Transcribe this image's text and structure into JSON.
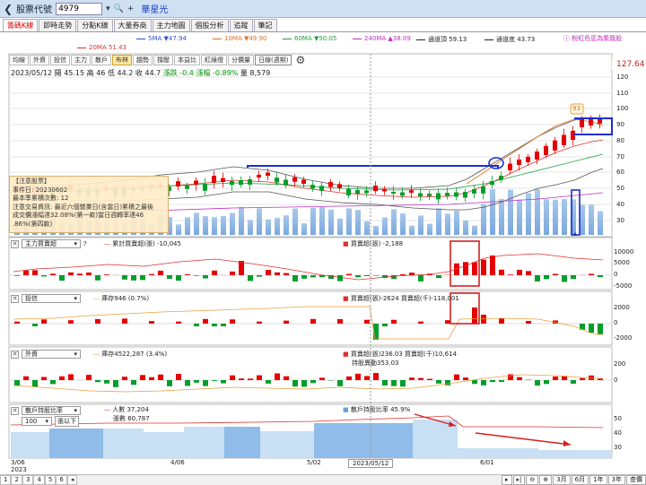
{
  "header": {
    "back_icon": "chevron-left-icon",
    "title": "股票代號",
    "code": "4979",
    "name": "華星光"
  },
  "tabs": [
    "籌碼K線",
    "即時走勢",
    "分點K線",
    "大量券商",
    "主力地圖",
    "個股分析",
    "追蹤",
    "筆記"
  ],
  "ma_legend": {
    "ma5": "5MA ▼47.94",
    "ma10": "10MA ▼49.90",
    "ma60": "60MA ▼50.05",
    "ma240": "240MA ▲38.09",
    "upper": "通道頂 59.13",
    "lower": "通道底 43.73",
    "ma20": "20MA 51.43",
    "hint": "粉紅色區為集簇股"
  },
  "toolbar": [
    "均線",
    "外資",
    "投信",
    "主力",
    "散戶",
    "布林",
    "趨勢",
    "撐壓",
    "本益比",
    "紅綠燈",
    "分價量",
    "日線(週期)"
  ],
  "ohlc": {
    "date": "2023/05/12",
    "open": "開 45.15",
    "high": "高 46",
    "low": "低 44.2",
    "close": "收 44.7",
    "chg": "漲跌 -0.4",
    "pct": "漲幅 -0.89%",
    "vol": "量 8,579"
  },
  "note": {
    "l1": "【注意股票】",
    "l2": "事件日: 20230602",
    "l3": "最本季累積次數: 12",
    "l4": "注意交易資訊: 最近六個營業日(含當日)累積之最後",
    "l5": "成交價漲幅達32.08%(第一款)當日週轉率達46",
    "l6": ".86%(第四款)"
  },
  "price_axis": {
    "labels": [
      "120",
      "110",
      "100",
      "90",
      "80",
      "70",
      "60",
      "50",
      "40",
      "30"
    ],
    "current": "127.64",
    "marker": "93"
  },
  "panel1": {
    "select": "主力買賣超",
    "legend_a": "累計買賣超(張) -10,045",
    "legend_b": "買賣超(張) -2,188",
    "axis": [
      "10000",
      "5000",
      "0",
      "-5000"
    ]
  },
  "panel2": {
    "select": "投信",
    "legend_a": "庫存946 (0.7%)",
    "legend_b": "買賣超(張)-2624 買賣超(千)-118,001",
    "axis": [
      "2000",
      "0",
      "-2000"
    ]
  },
  "panel3": {
    "select": "外資",
    "legend_a": "庫存4522,287 (3.4%)",
    "legend_b": "買賣超(張)236.03 買賣超(千)10,614",
    "legend_c": "持股異動353.03",
    "axis": [
      "200",
      "0"
    ]
  },
  "panel4": {
    "select": "散戶持股比率",
    "sub_select": "100",
    "sub_label": "張以下",
    "legend_a": "人數 37,204",
    "legend_b": "張數 60,787",
    "legend_c": "散戶持股比率 45.9%",
    "axis": [
      "50",
      "40",
      "30"
    ]
  },
  "xaxis": {
    "labels": [
      "3/06",
      "4/06",
      "5/02",
      "6/01"
    ],
    "year": "2023",
    "cursor": "2023/05/12"
  },
  "bottom": {
    "pages": [
      "1",
      "2",
      "3",
      "4",
      "5",
      "6"
    ],
    "ranges": [
      "3月",
      "6月",
      "1年",
      "3年",
      "查價"
    ]
  },
  "colors": {
    "up": "#e60000",
    "down": "#009e2a",
    "volume": "#6a9fd8",
    "box": "#1a2fd0",
    "highlight": "#d62020"
  }
}
